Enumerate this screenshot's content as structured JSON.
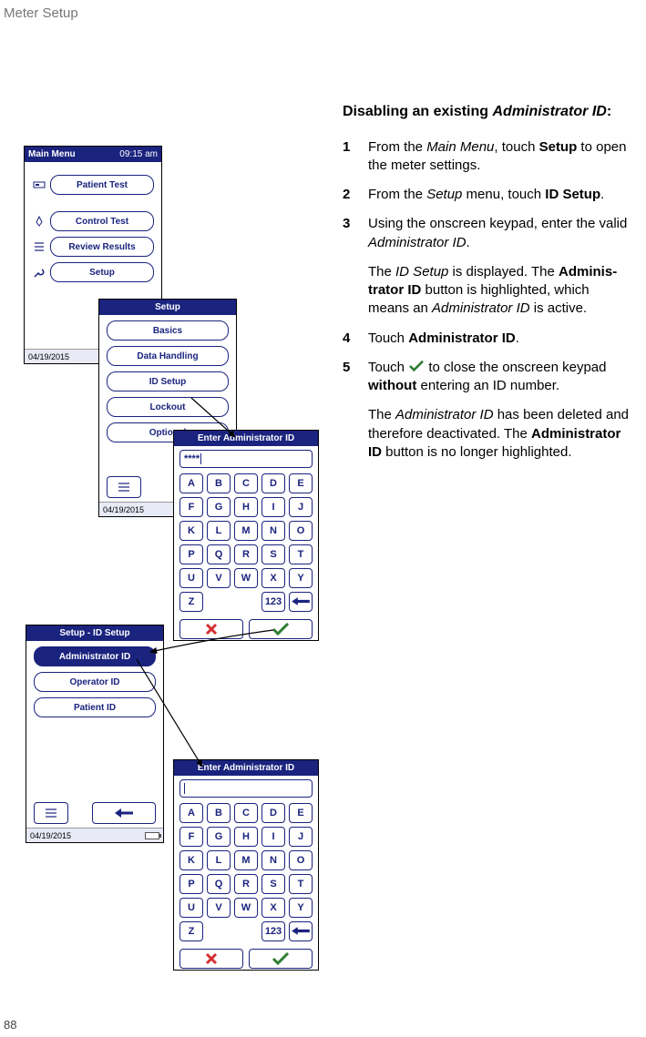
{
  "page_header": "Meter Setup",
  "page_number": "88",
  "instructions": {
    "title_prefix": "Disabling an existing ",
    "title_emph": "Administrator ID",
    "title_suffix": ":",
    "steps": [
      {
        "num": "1",
        "pre": "From the ",
        "ital1": "Main Menu",
        "mid": ", touch ",
        "bold": "Setup",
        "post": " to open the meter settings."
      },
      {
        "num": "2",
        "pre": "From the ",
        "ital1": "Setup",
        "mid": " menu, touch ",
        "bold": "ID Setup",
        "post": "."
      },
      {
        "num": "3",
        "pre": "Using the onscreen keypad, enter the valid ",
        "ital1": "Administrator ID",
        "mid": "",
        "bold": "",
        "post": "."
      }
    ],
    "note3": {
      "pre": "The ",
      "ital1": "ID Setup",
      "mid": " is displayed. The ",
      "bold1": "Admi­nis­trator ID",
      "mid2": " button is highlighted, which means an ",
      "ital2": "Administrator ID",
      "post": " is active."
    },
    "step4": {
      "num": "4",
      "pre": "Touch ",
      "bold": "Administrator ID",
      "post": "."
    },
    "step5": {
      "num": "5",
      "pre": "Touch ",
      "mid": " to close the onscreen keypad ",
      "bold": "without",
      "post": " entering an ID number."
    },
    "note5": {
      "pre": "The ",
      "ital1": "Administrator ID",
      "mid": " has been deleted and therefore deactivated. The ",
      "bold1": "Admi­nis­trator ID",
      "post": " button is no longer highlighted."
    }
  },
  "main_menu": {
    "title": "Main Menu",
    "time": "09:15 am",
    "items": [
      "Patient Test",
      "Control Test",
      "Review Results",
      "Setup"
    ],
    "date": "04/19/2015"
  },
  "setup_menu": {
    "title": "Setup",
    "items": [
      "Basics",
      "Data Handling",
      "ID Setup",
      "Lockout",
      "Optional"
    ],
    "date": "04/19/2015"
  },
  "id_setup_menu": {
    "title": "Setup - ID Setup",
    "items": [
      "Administrator ID",
      "Operator ID",
      "Patient ID"
    ],
    "date": "04/19/2015"
  },
  "keypad1": {
    "title": "Enter Administrator ID",
    "display": "****",
    "keys": [
      "A",
      "B",
      "C",
      "D",
      "E",
      "F",
      "G",
      "H",
      "I",
      "J",
      "K",
      "L",
      "M",
      "N",
      "O",
      "P",
      "Q",
      "R",
      "S",
      "T",
      "U",
      "V",
      "W",
      "X",
      "Y",
      "Z",
      "",
      "",
      "123",
      "bksp"
    ]
  },
  "keypad2": {
    "title": "Enter Administrator ID",
    "display": "",
    "keys": [
      "A",
      "B",
      "C",
      "D",
      "E",
      "F",
      "G",
      "H",
      "I",
      "J",
      "K",
      "L",
      "M",
      "N",
      "O",
      "P",
      "Q",
      "R",
      "S",
      "T",
      "U",
      "V",
      "W",
      "X",
      "Y",
      "Z",
      "",
      "",
      "123",
      "bksp"
    ]
  }
}
